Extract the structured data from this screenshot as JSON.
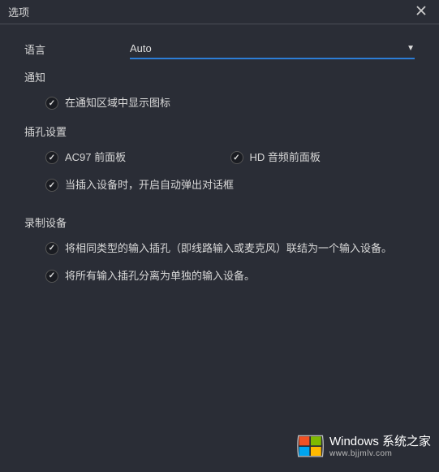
{
  "titlebar": {
    "title": "选项"
  },
  "language": {
    "label": "语言",
    "selected": "Auto"
  },
  "notification": {
    "heading": "通知",
    "show_icon": "在通知区域中显示图标"
  },
  "jack": {
    "heading": "插孔设置",
    "ac97": "AC97 前面板",
    "hd_audio": "HD 音频前面板",
    "auto_popup": "当插入设备时，开启自动弹出对话框"
  },
  "recording": {
    "heading": "录制设备",
    "combine": "将相同类型的输入插孔（即线路输入或麦克风）联结为一个输入设备。",
    "separate": "将所有输入插孔分离为单独的输入设备。"
  },
  "watermark": {
    "main": "Windows 系统之家",
    "sub": "www.bjjmlv.com"
  }
}
